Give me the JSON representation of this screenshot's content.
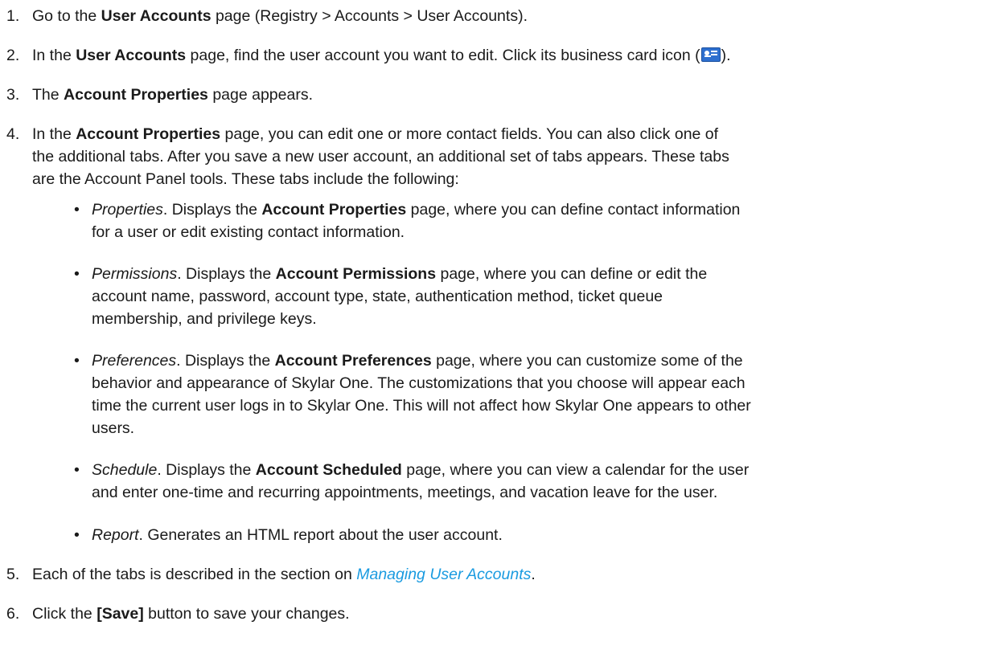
{
  "steps": [
    {
      "num": "1.",
      "parts": [
        "Go to the ",
        "User Accounts",
        " page (Registry > Accounts > User Accounts)."
      ]
    },
    {
      "num": "2.",
      "parts": [
        "In the ",
        "User Accounts",
        " page, find the user account you want to edit. Click its business card icon (",
        ")."
      ],
      "icon": "business-card-icon"
    },
    {
      "num": "3.",
      "parts": [
        "The ",
        "Account Properties",
        " page appears."
      ]
    },
    {
      "num": "4.",
      "parts": [
        "In the ",
        "Account Properties",
        " page, you can edit one or more contact fields. You can also click one of",
        "the additional tabs. After you save a new user account, an additional set of tabs appears. These tabs",
        "are the Account Panel tools. These tabs include the following:"
      ]
    },
    {
      "num": "5.",
      "parts": [
        "Each of the tabs is described in the section on ",
        "Managing User Accounts",
        "."
      ]
    },
    {
      "num": "6.",
      "parts": [
        "Click the ",
        "[Save]",
        " button to save your changes."
      ]
    }
  ],
  "bullets": [
    {
      "marker": "•",
      "term": "Properties",
      "lines": [
        [
          ". Displays the ",
          "Account Properties",
          " page, where you can define contact information"
        ],
        [
          "for a user or edit existing contact information."
        ]
      ]
    },
    {
      "marker": "•",
      "term": "Permissions",
      "lines": [
        [
          ". Displays the ",
          "Account Permissions",
          " page, where you can define or edit the"
        ],
        [
          "account name, password, account type, state, authentication method, ticket queue"
        ],
        [
          "membership, and privilege keys."
        ]
      ]
    },
    {
      "marker": "•",
      "term": "Preferences",
      "lines": [
        [
          ". Displays the ",
          "Account Preferences",
          " page, where you can customize some of the"
        ],
        [
          "behavior and appearance of Skylar One. The customizations that you choose will appear each"
        ],
        [
          "time the current user logs in to Skylar One. This will not affect how Skylar One appears to other"
        ],
        [
          "users."
        ]
      ]
    },
    {
      "marker": "•",
      "term": "Schedule",
      "lines": [
        [
          ". Displays the ",
          "Account Scheduled",
          " page, where you can view a calendar for the user"
        ],
        [
          "and enter one-time and recurring appointments, meetings, and vacation leave for the user."
        ]
      ]
    },
    {
      "marker": "•",
      "term": "Report",
      "lines": [
        [
          ". Generates an HTML report about the user account."
        ]
      ]
    }
  ]
}
